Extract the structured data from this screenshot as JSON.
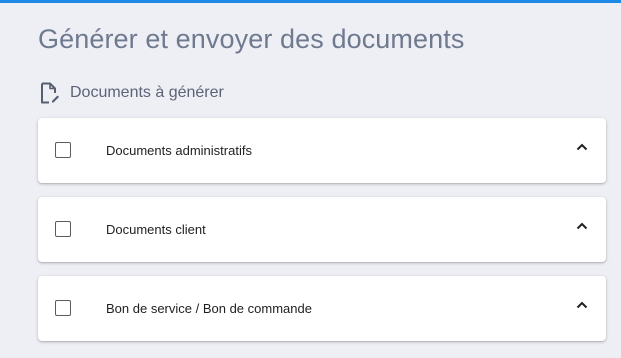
{
  "page": {
    "title": "Générer et envoyer des documents"
  },
  "section": {
    "title": "Documents à générer",
    "icon": "document-edit-icon"
  },
  "accordion": {
    "items": [
      {
        "label": "Documents administratifs",
        "checked": false,
        "expanded": true
      },
      {
        "label": "Documents client",
        "checked": false,
        "expanded": true
      },
      {
        "label": "Bon de service / Bon de commande",
        "checked": false,
        "expanded": true
      }
    ]
  },
  "colors": {
    "accent": "#1e88e5",
    "background": "#eeeef5",
    "card": "#ffffff",
    "title": "#6f7a8f"
  }
}
